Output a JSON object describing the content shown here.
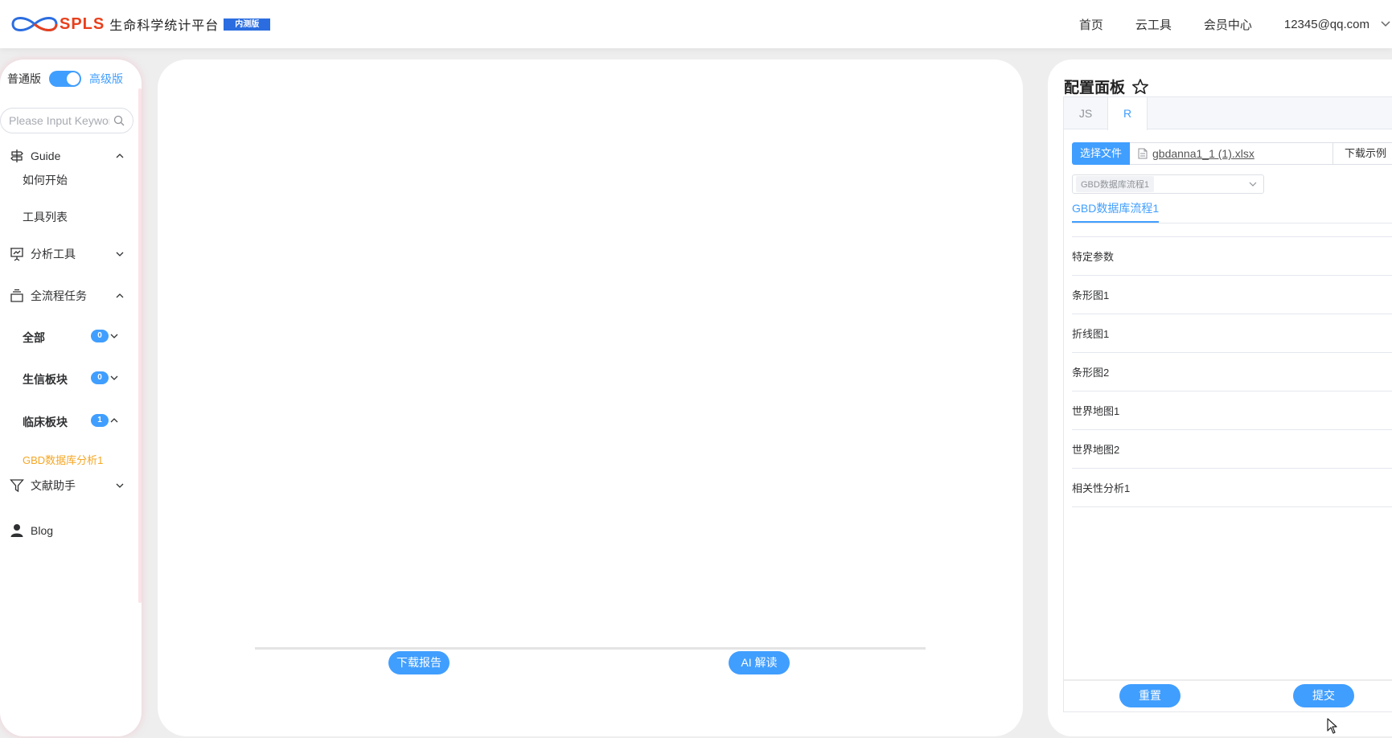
{
  "header": {
    "logo_text": "SPLS",
    "logo_cn": "生命科学统计平台",
    "logo_badge": "内测版",
    "nav": [
      "首页",
      "云工具",
      "会员中心"
    ],
    "user": "12345@qq.com"
  },
  "sidebar": {
    "mode_basic": "普通版",
    "mode_advanced": "高级版",
    "mode_advanced_on": true,
    "search_placeholder": "Please Input Keyword",
    "guide": {
      "label": "Guide",
      "icon": "signpost-icon",
      "children": [
        "如何开始",
        "工具列表"
      ]
    },
    "analysis": {
      "label": "分析工具",
      "icon": "presentation-chart-icon"
    },
    "workflow": {
      "label": "全流程任务",
      "icon": "layers-icon",
      "groups": [
        {
          "label": "全部",
          "count": "0"
        },
        {
          "label": "生信板块",
          "count": "0"
        },
        {
          "label": "临床板块",
          "count": "1"
        }
      ],
      "active_item": "GBD数据库分析1"
    },
    "literature": {
      "label": "文献助手",
      "icon": "filter-icon"
    },
    "blog": {
      "label": "Blog",
      "icon": "user-icon"
    }
  },
  "center": {
    "download_report": "下载报告",
    "ai_interpret": "AI 解读"
  },
  "config": {
    "title": "配置面板",
    "tabs": [
      "JS",
      "R"
    ],
    "active_tab": "R",
    "choose_file": "选择文件",
    "file_name": "gbdanna1_1 (1).xlsx",
    "download_example": "下载示例",
    "workflow_select": "GBD数据库流程1",
    "workflow_tab": "GBD数据库流程1",
    "sections": [
      "特定参数",
      "条形图1",
      "折线图1",
      "条形图2",
      "世界地图1",
      "世界地图2",
      "相关性分析1"
    ],
    "reset": "重置",
    "submit": "提交"
  }
}
